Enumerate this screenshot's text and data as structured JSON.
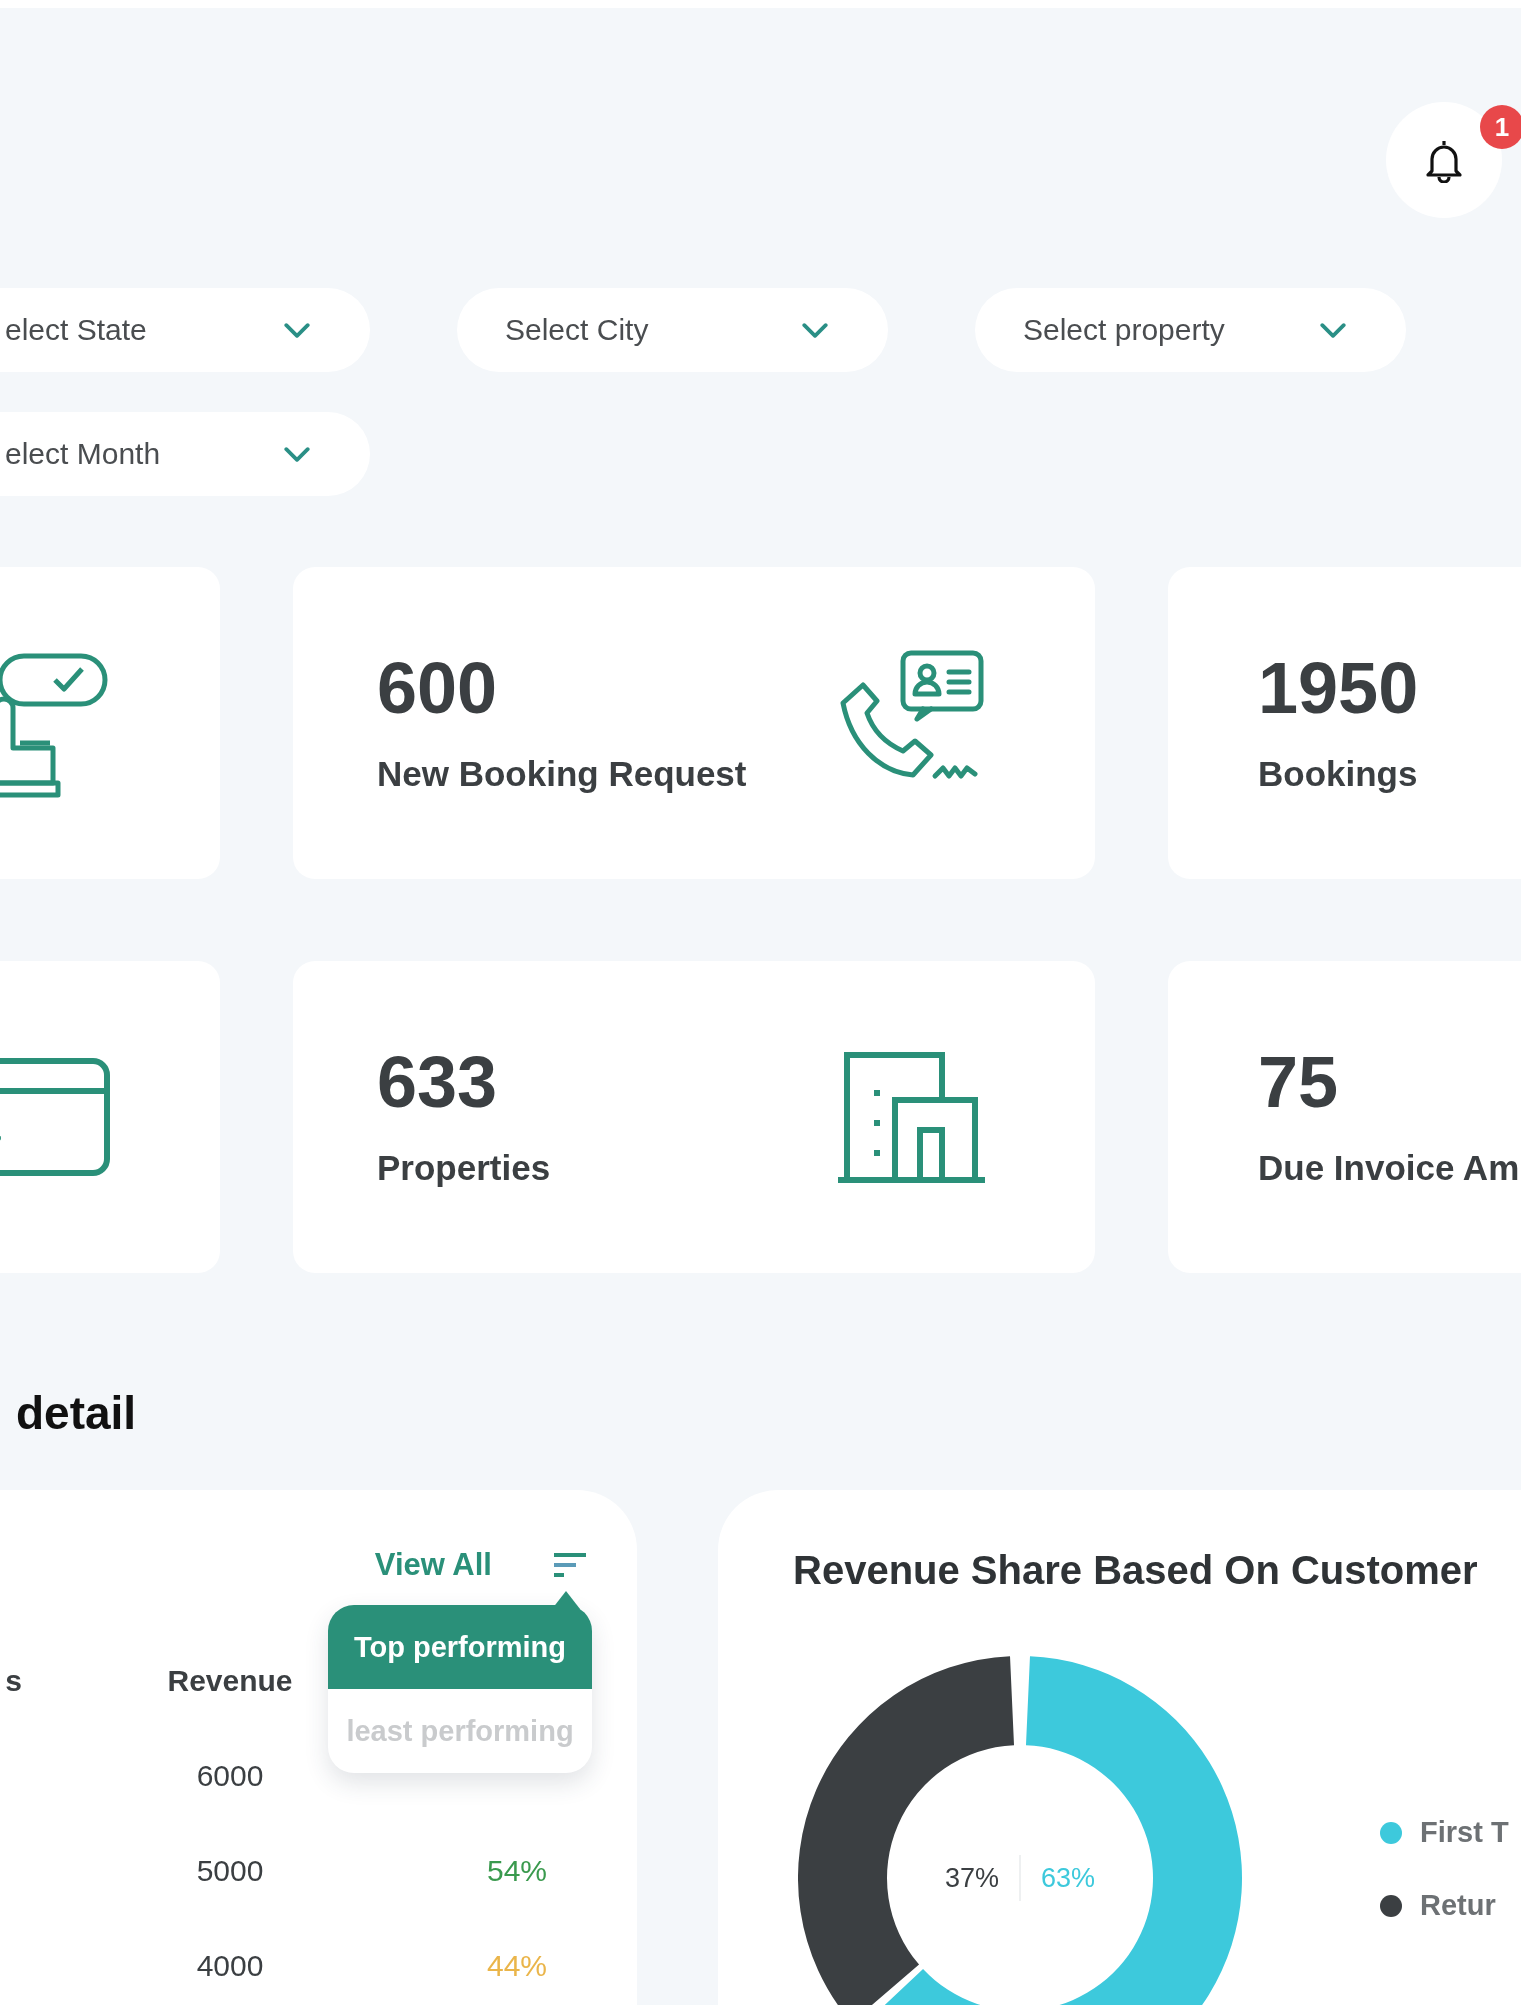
{
  "header": {
    "notifications": {
      "badge": "1"
    }
  },
  "filters": [
    [
      {
        "placeholder": "elect State"
      },
      {
        "placeholder": "Select City"
      },
      {
        "placeholder": "Select property"
      }
    ],
    [
      {
        "placeholder": "elect Month"
      }
    ]
  ],
  "stat_cards": [
    [
      {
        "kind": "hand-check"
      },
      {
        "kind": "phone-contact",
        "value": "600",
        "label": "New Booking Request"
      },
      {
        "kind": "none",
        "value": "1950",
        "label": "Bookings"
      }
    ],
    [
      {
        "kind": "credit-card"
      },
      {
        "kind": "building",
        "value": "633",
        "label": "Properties"
      },
      {
        "kind": "none",
        "value": "75",
        "label": "Due Invoice Am"
      }
    ]
  ],
  "section_title": "detail",
  "performance": {
    "view_all": "View All",
    "columns": [
      "s",
      "Revenue"
    ],
    "rows": [
      {
        "revenue": "6000"
      },
      {
        "revenue": "5000",
        "share": "54%",
        "color": "#3a9a4e"
      },
      {
        "revenue": "4000",
        "share": "44%",
        "color": "#eab54a"
      }
    ],
    "menu": [
      {
        "label": "Top performing",
        "selected": true
      },
      {
        "label": "least performing",
        "selected": false
      }
    ]
  },
  "revenue_share": {
    "title": "Revenue Share Based On Customer",
    "chart_data": {
      "type": "donut",
      "categories": [
        "First T",
        "Retur"
      ],
      "values": [
        63,
        37
      ],
      "value_labels": [
        "63%",
        "37%"
      ]
    },
    "legend": [
      {
        "color": "#3dc9dc"
      },
      {
        "color": "#3b3f42"
      }
    ]
  }
}
